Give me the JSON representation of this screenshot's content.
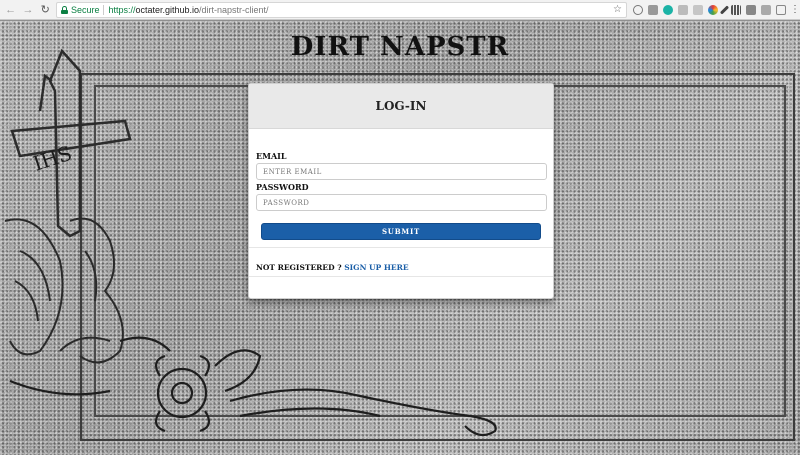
{
  "browser": {
    "secure_label": "Secure",
    "url_scheme": "https://",
    "url_host": "octater.github.io",
    "url_path": "/dirt-napstr-client/",
    "icons": [
      "back-icon",
      "forward-icon",
      "reload-icon",
      "lock-icon",
      "star-icon",
      "menu-icon"
    ]
  },
  "site": {
    "title": "DIRT NAPSTR"
  },
  "login": {
    "header": "LOG-IN",
    "email_label": "EMAIL",
    "email_placeholder": "ENTER EMAIL",
    "password_label": "PASSWORD",
    "password_placeholder": "PASSWORD",
    "submit_label": "SUBMIT",
    "register_prompt": "NOT REGISTERED ?",
    "register_link": "SIGN UP HERE"
  },
  "colors": {
    "accent": "#1b5fa8",
    "secure_green": "#0b8043"
  }
}
